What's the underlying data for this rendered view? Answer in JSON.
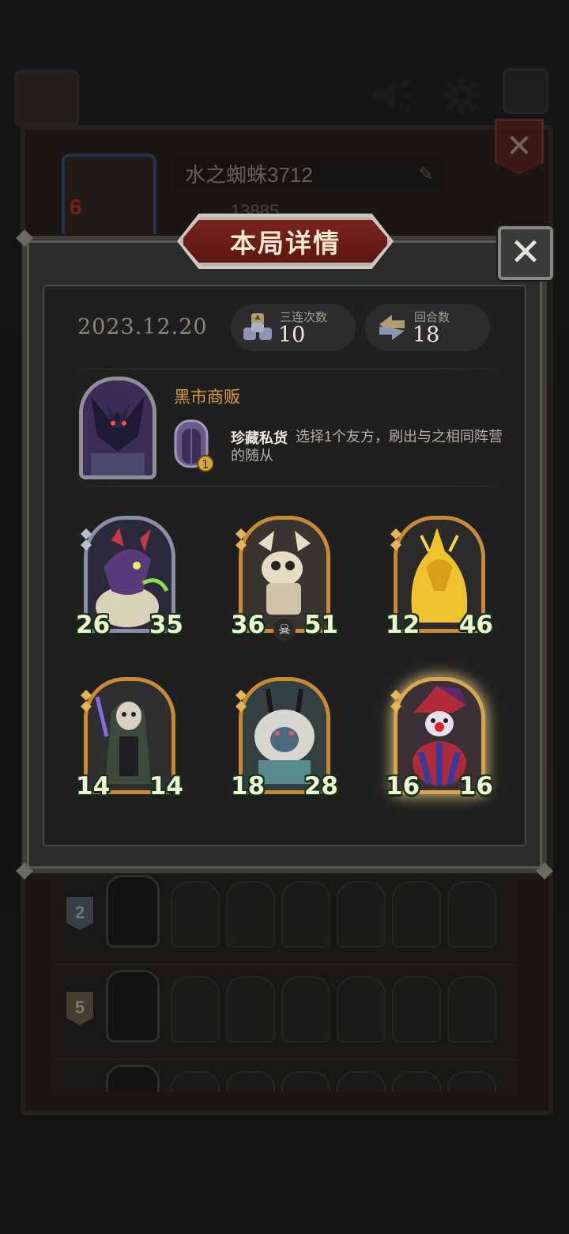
{
  "background": {
    "player_name": "水之蜘蛛3712",
    "player_level": "6",
    "score": "13885",
    "rows": [
      {
        "rank": "2"
      },
      {
        "rank": "5"
      },
      {
        "rank": ""
      }
    ]
  },
  "modal": {
    "title": "本局详情",
    "date": "2023.12.20",
    "stats": [
      {
        "label": "三连次数",
        "value": "10",
        "icon": "triple-icon"
      },
      {
        "label": "回合数",
        "value": "18",
        "icon": "rounds-icon"
      }
    ],
    "hero": {
      "name": "黑市商贩",
      "skill_name": "珍藏私货",
      "skill_desc": "选择1个友方，刷出与之相同阵营的随从",
      "skill_cost": "1"
    },
    "minions": [
      {
        "attack": "26",
        "health": "35",
        "frame": "silver",
        "theme": "purple-dragon"
      },
      {
        "attack": "36",
        "health": "51",
        "frame": "gold",
        "theme": "bone-dragon"
      },
      {
        "attack": "12",
        "health": "46",
        "frame": "gold",
        "theme": "golden-dragon"
      },
      {
        "attack": "14",
        "health": "14",
        "frame": "gold",
        "theme": "hooded-rogue"
      },
      {
        "attack": "18",
        "health": "28",
        "frame": "gold",
        "theme": "white-beast"
      },
      {
        "attack": "16",
        "health": "16",
        "frame": "gold-glow",
        "theme": "clown"
      }
    ]
  },
  "colors": {
    "accent_gold": "#d79a3a",
    "banner_red": "#7a231f",
    "stat_green": "#eef7d2"
  }
}
